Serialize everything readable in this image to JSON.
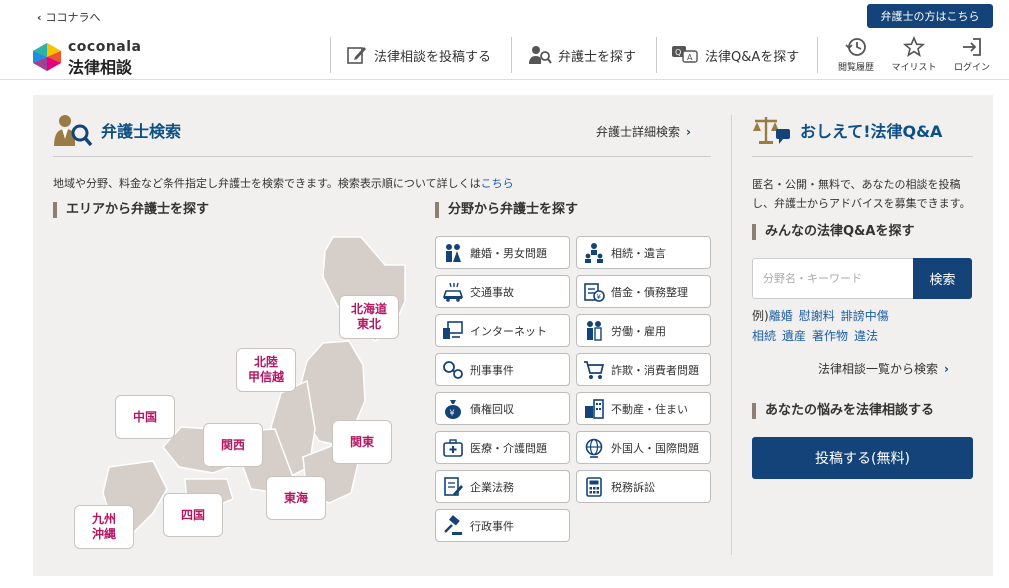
{
  "header": {
    "back_link": "ココナラへ",
    "lawyer_button": "弁護士の方はこちら",
    "logo_en": "coconala",
    "logo_jp": "法律相談",
    "nav": [
      {
        "label": "法律相談を投稿する",
        "icon": "edit-icon"
      },
      {
        "label": "弁護士を探す",
        "icon": "lawyer-search-icon"
      },
      {
        "label": "法律Q&Aを探す",
        "icon": "qa-icon"
      }
    ],
    "icon_nav": [
      {
        "label": "閲覧履歴",
        "icon": "history-icon"
      },
      {
        "label": "マイリスト",
        "icon": "star-icon"
      },
      {
        "label": "ログイン",
        "icon": "login-icon"
      }
    ]
  },
  "lawyer_search": {
    "title": "弁護士検索",
    "detail_link": "弁護士詳細検索",
    "intro": "地域や分野、料金など条件指定し弁護士を検索できます。検索表示順について詳しくは",
    "intro_link": "こちら",
    "area_heading": "エリアから弁護士を探す",
    "field_heading": "分野から弁護士を探す",
    "regions": [
      {
        "id": "hokkaido",
        "line1": "北海道",
        "line2": "東北"
      },
      {
        "id": "hokuriku",
        "line1": "北陸",
        "line2": "甲信越"
      },
      {
        "id": "chugoku",
        "line1": "中国",
        "line2": ""
      },
      {
        "id": "kansai",
        "line1": "関西",
        "line2": ""
      },
      {
        "id": "kanto",
        "line1": "関東",
        "line2": ""
      },
      {
        "id": "tokai",
        "line1": "東海",
        "line2": ""
      },
      {
        "id": "shikoku",
        "line1": "四国",
        "line2": ""
      },
      {
        "id": "kyushu",
        "line1": "九州",
        "line2": "沖縄"
      }
    ],
    "categories": [
      {
        "label": "離婚・男女問題",
        "icon": "couple-icon"
      },
      {
        "label": "相続・遺言",
        "icon": "family-tree-icon"
      },
      {
        "label": "交通事故",
        "icon": "car-accident-icon"
      },
      {
        "label": "借金・債務整理",
        "icon": "debt-icon"
      },
      {
        "label": "インターネット",
        "icon": "computer-icon"
      },
      {
        "label": "労働・雇用",
        "icon": "worker-icon"
      },
      {
        "label": "刑事事件",
        "icon": "handcuffs-icon"
      },
      {
        "label": "詐欺・消費者問題",
        "icon": "cart-icon"
      },
      {
        "label": "債権回収",
        "icon": "money-bag-icon"
      },
      {
        "label": "不動産・住まい",
        "icon": "building-icon"
      },
      {
        "label": "医療・介護問題",
        "icon": "medical-icon"
      },
      {
        "label": "外国人・国際問題",
        "icon": "globe-icon"
      },
      {
        "label": "企業法務",
        "icon": "contract-icon"
      },
      {
        "label": "税務訴訟",
        "icon": "calculator-icon"
      },
      {
        "label": "行政事件",
        "icon": "gavel-icon"
      }
    ]
  },
  "qa": {
    "title": "おしえて!法律Q&A",
    "intro": "匿名・公開・無料で、あなたの相談を投稿し、弁護士からアドバイスを募集できます。",
    "find_heading": "みんなの法律Q&Aを探す",
    "search_placeholder": "分野名・キーワード",
    "search_button": "検索",
    "examples_prefix": "例)",
    "keywords": [
      "離婚",
      "慰謝料",
      "誹謗中傷",
      "相続",
      "遺産",
      "著作物",
      "違法"
    ],
    "list_link": "法律相談一覧から検索",
    "consult_heading": "あなたの悩みを法律相談する",
    "post_button": "投稿する(無料)"
  },
  "colors": {
    "primary": "#14437a",
    "title": "#0e4f85",
    "region_text": "#b51662",
    "map": "#d6cfc9",
    "panel_bg": "#f1f0ef"
  }
}
